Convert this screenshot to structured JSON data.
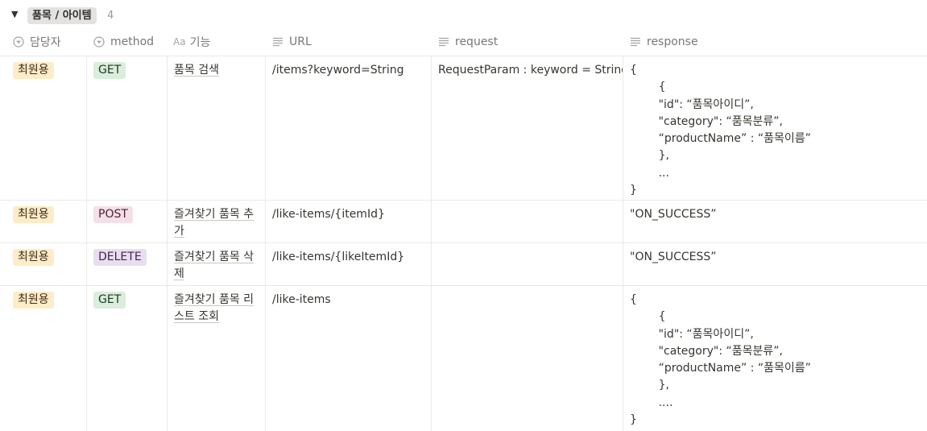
{
  "group": {
    "toggle_glyph": "▼",
    "name": "품목 / 아이템",
    "count": "4"
  },
  "columns": {
    "owner": {
      "label": "담당자",
      "icon": "select-icon"
    },
    "method": {
      "label": "method",
      "icon": "select-icon"
    },
    "feature": {
      "label": "기능",
      "icon_text": "Aa",
      "icon": "title-icon"
    },
    "url": {
      "label": "URL",
      "icon": "text-lines-icon"
    },
    "request": {
      "label": "request",
      "icon": "text-lines-icon"
    },
    "response": {
      "label": "response",
      "icon": "text-lines-icon"
    }
  },
  "rows": [
    {
      "owner": "최원용",
      "method": "GET",
      "feature": "품목 검색",
      "url": "/items?keyword=String",
      "request": "RequestParam : keyword = String",
      "response": "{\n        {\n        \"id\": “품목아이디”,\n        \"category\": “품목분류”,\n        “productName” : “품목이름”\n        },\n        ...\n}"
    },
    {
      "owner": "최원용",
      "method": "POST",
      "feature": "즐겨찾기 품목 추가",
      "url": "/like-items/{itemId}",
      "request": "",
      "response": "\"ON_SUCCESS”"
    },
    {
      "owner": "최원용",
      "method": "DELETE",
      "feature": "즐겨찾기 품목 삭제",
      "url": "/like-items/{likeItemId}",
      "request": "",
      "response": "\"ON_SUCCESS”"
    },
    {
      "owner": "최원용",
      "method": "GET",
      "feature": "즐겨찾기 품목 리스트 조회",
      "url": "/like-items",
      "request": "",
      "response": "{\n        {\n        \"id\": “품목아이디”,\n        \"category\": “품목분류”,\n        “productName” : “품목이름”\n        },\n        ....\n}"
    }
  ],
  "colors": {
    "owner_tag": "#fdecc8",
    "get_tag": "#dbeddb",
    "post_tag": "#f5e0e9",
    "delete_tag": "#e8deee",
    "border": "#e9e9e7"
  }
}
